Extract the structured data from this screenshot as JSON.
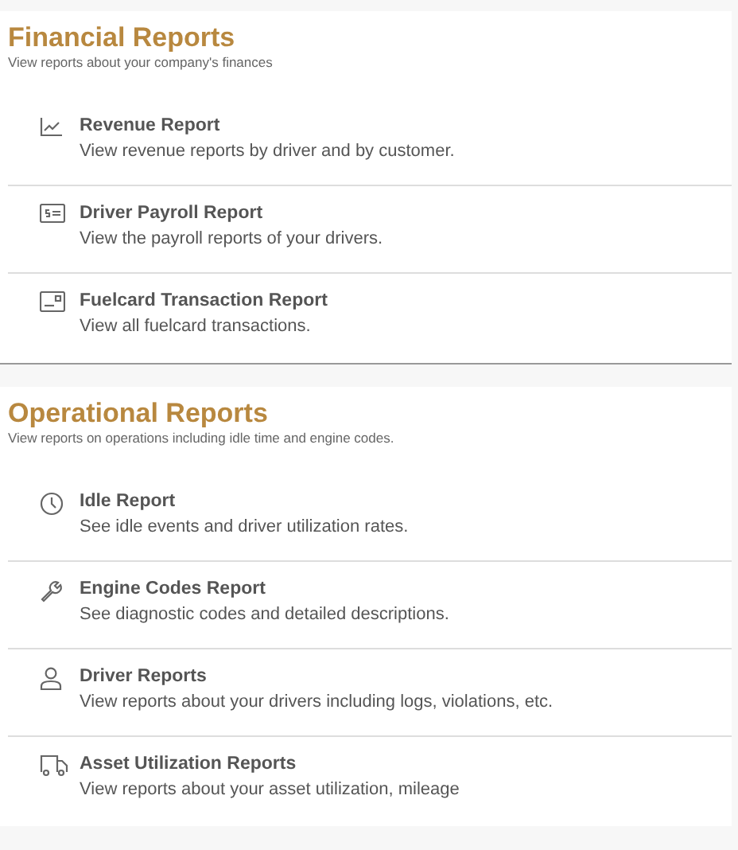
{
  "sections": [
    {
      "title": "Financial Reports",
      "subtitle": "View reports about your company's finances",
      "items": [
        {
          "kind": "chart",
          "title": "Revenue Report",
          "description": "View revenue reports by driver and by customer."
        },
        {
          "kind": "payroll",
          "title": "Driver Payroll Report",
          "description": "View the payroll reports of your drivers."
        },
        {
          "kind": "card",
          "title": "Fuelcard Transaction Report",
          "description": "View all fuelcard transactions."
        }
      ]
    },
    {
      "title": "Operational Reports",
      "subtitle": "View reports on operations including idle time and engine codes.",
      "items": [
        {
          "kind": "clock",
          "title": "Idle Report",
          "description": "See idle events and driver utilization rates."
        },
        {
          "kind": "wrench",
          "title": "Engine Codes Report",
          "description": "See diagnostic codes and detailed descriptions."
        },
        {
          "kind": "person",
          "title": "Driver Reports",
          "description": "View reports about your drivers including logs, violations, etc."
        },
        {
          "kind": "truck",
          "title": "Asset Utilization Reports",
          "description": "View reports about your asset utilization, mileage"
        }
      ]
    }
  ]
}
